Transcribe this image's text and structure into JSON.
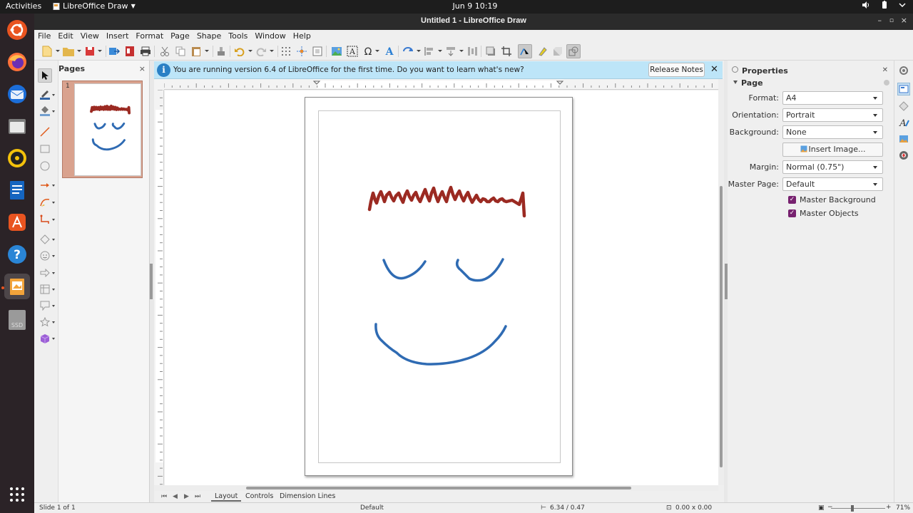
{
  "topbar": {
    "activities": "Activities",
    "app_menu": "LibreOffice Draw",
    "clock": "Jun 9  10:19"
  },
  "window": {
    "title": "Untitled 1 - LibreOffice Draw"
  },
  "menu": [
    "File",
    "Edit",
    "View",
    "Insert",
    "Format",
    "Page",
    "Shape",
    "Tools",
    "Window",
    "Help"
  ],
  "pages_pane": {
    "title": "Pages",
    "page_number": "1"
  },
  "infobar": {
    "message": "You are running version 6.4 of LibreOffice for the first time. Do you want to learn what's new?",
    "button": "Release Notes"
  },
  "sidebar": {
    "title": "Properties",
    "section": "Page",
    "format_label": "Format:",
    "format_value": "A4",
    "orientation_label": "Orientation:",
    "orientation_value": "Portrait",
    "background_label": "Background:",
    "background_value": "None",
    "insert_image": "Insert Image...",
    "margin_label": "Margin:",
    "margin_value": "Normal (0.75\")",
    "master_page_label": "Master Page:",
    "master_page_value": "Default",
    "master_background": "Master Background",
    "master_objects": "Master Objects"
  },
  "tabs": [
    "Layout",
    "Controls",
    "Dimension Lines"
  ],
  "status": {
    "slide": "Slide 1 of 1",
    "layout": "Default",
    "position": "6.34 / 0.47",
    "size": "0.00 x 0.00",
    "zoom": "71%"
  },
  "colors": {
    "hair_stroke": "#9b2a22",
    "face_stroke": "#2f6bb3",
    "accent": "#e95420",
    "checkbox": "#77216f"
  }
}
